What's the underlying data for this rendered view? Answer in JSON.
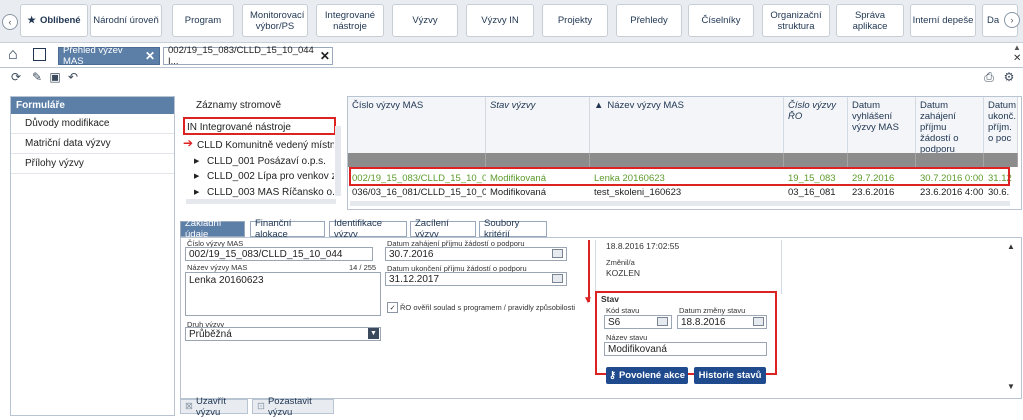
{
  "nav": {
    "items": [
      {
        "label": "Oblíbené"
      },
      {
        "label": "Národní úroveň"
      },
      {
        "label": "Program"
      },
      {
        "label": "Monitorovací výbor/PS"
      },
      {
        "label": "Integrované nástroje"
      },
      {
        "label": "Výzvy"
      },
      {
        "label": "Výzvy IN"
      },
      {
        "label": "Projekty"
      },
      {
        "label": "Přehledy"
      },
      {
        "label": "Číselníky"
      },
      {
        "label": "Organizační struktura"
      },
      {
        "label": "Správa aplikace"
      },
      {
        "label": "Interní depeše"
      },
      {
        "label": "Da"
      }
    ]
  },
  "tabs": {
    "tab1": "Přehled výzev MAS",
    "tab2": "002/19_15_083/CLLD_15_10_044 I..."
  },
  "left_panel": {
    "header": "Formuláře",
    "items": [
      "Důvody modifikace",
      "Matriční data výzvy",
      "Přílohy výzvy"
    ]
  },
  "tree": {
    "title": "Záznamy stromově",
    "root": "IN Integrované nástroje",
    "child": "CLLD Komunitně vedený místní rc",
    "items": [
      "CLLD_001 Posázaví o.p.s.",
      "CLLD_002 Lípa pro venkov z.s.",
      "CLLD_003 MAS Říčansko o.p.s."
    ]
  },
  "grid": {
    "headers": [
      "Číslo výzvy MAS",
      "Stav výzvy",
      "Název výzvy MAS",
      "Číslo výzvy ŘO",
      "Datum vyhlášení výzvy MAS",
      "Datum zahájení příjmu žádostí o podporu",
      "Datum ukonč. příjm. o poc"
    ],
    "rows": [
      [
        "002/19_15_083/CLLD_15_10_044",
        "Modifikovaná",
        "Lenka 20160623",
        "19_15_083",
        "29.7.2016",
        "30.7.2016 0:00",
        "31.12"
      ],
      [
        "036/03_16_081/CLLD_15_10_012",
        "Modifikovaná",
        "test_skoleni_160623",
        "03_16_081",
        "23.6.2016",
        "23.6.2016 4:00",
        "30.6."
      ]
    ]
  },
  "form_tabs": [
    "Základní údaje",
    "Finanční alokace",
    "Identifikace výzvy",
    "Zacílení výzvy",
    "Soubory kritérií"
  ],
  "form": {
    "cislo_label": "Číslo výzvy MAS",
    "cislo_value": "002/19_15_083/CLLD_15_10_044",
    "nazev_label": "Název výzvy MAS",
    "nazev_counter": "14 / 255",
    "nazev_value": "Lenka 20160623",
    "druh_label": "Druh výzvy",
    "druh_value": "Průběžná",
    "zahajeni_label": "Datum zahájení příjmu žádostí o podporu",
    "zahajeni_value": "30.7.2016",
    "ukonceni_label": "Datum ukončení příjmu žádostí o podporu",
    "ukonceni_value": "31.12.2017",
    "check_label": "ŘO ověřil soulad s programem / pravidly způsobilosti",
    "changed_date": "18.8.2016 17:02:55",
    "changed_by_label": "Změnil/a",
    "changed_by": "KOZLEN",
    "stav_title": "Stav",
    "kod_label": "Kód stavu",
    "kod_value": "S6",
    "datum_zmeny_label": "Datum změny stavu",
    "datum_zmeny_value": "18.8.2016",
    "nazev_stavu_label": "Název stavu",
    "nazev_stavu_value": "Modifikovaná",
    "btn_povolene": "Povolené akce",
    "btn_historie": "Historie stavů"
  },
  "bottom": {
    "uzavrit": "Uzavřít výzvu",
    "pozastavit": "Pozastavit výzvu"
  },
  "colors": {
    "accent": "#5c7fa8",
    "highlight": "#dd2222",
    "green": "#5c9b2a",
    "button": "#1f4b8e"
  }
}
